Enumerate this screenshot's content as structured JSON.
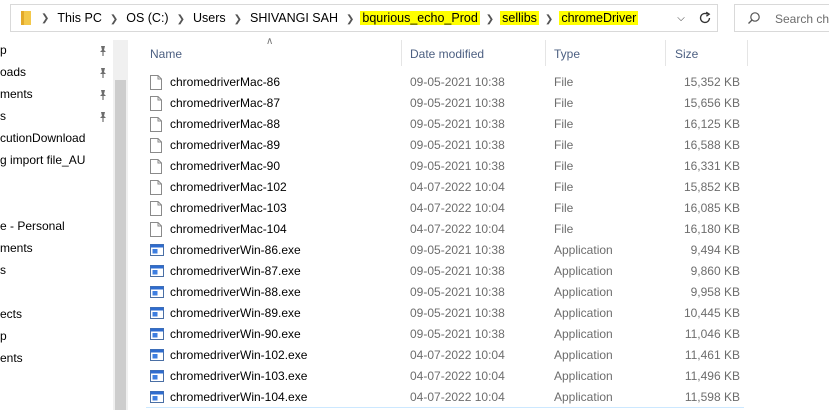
{
  "address": {
    "crumbs": [
      {
        "label": "This PC",
        "highlight": false
      },
      {
        "label": "OS (C:)",
        "highlight": false
      },
      {
        "label": "Users",
        "highlight": false
      },
      {
        "label": "SHIVANGI SAH",
        "highlight": false
      },
      {
        "label": "bqurious_echo_Prod",
        "highlight": true
      },
      {
        "label": "sellibs",
        "highlight": true
      },
      {
        "label": "chromeDriver",
        "highlight": true
      }
    ],
    "highlight_color": "#ffff00"
  },
  "search": {
    "placeholder": "Search chr"
  },
  "nav": {
    "items": [
      {
        "label": "p",
        "pinned": true
      },
      {
        "label": "oads",
        "pinned": true
      },
      {
        "label": "ments",
        "pinned": true
      },
      {
        "label": "s",
        "pinned": true
      },
      {
        "label": "cutionDownload",
        "pinned": false
      },
      {
        "label": "g import file_AU",
        "pinned": false
      },
      {
        "label": "",
        "pinned": false
      },
      {
        "label": "",
        "pinned": false
      },
      {
        "label": "e - Personal",
        "pinned": false
      },
      {
        "label": "ments",
        "pinned": false
      },
      {
        "label": "s",
        "pinned": false
      },
      {
        "label": "",
        "pinned": false
      },
      {
        "label": "ects",
        "pinned": false
      },
      {
        "label": "p",
        "pinned": false
      },
      {
        "label": "ents",
        "pinned": false
      }
    ]
  },
  "columns": {
    "name": "Name",
    "date": "Date modified",
    "type": "Type",
    "size": "Size"
  },
  "files": [
    {
      "name": "chromedriverMac-86",
      "date": "09-05-2021 10:38",
      "type": "File",
      "size": "15,352 KB",
      "icon": "file-icon"
    },
    {
      "name": "chromedriverMac-87",
      "date": "09-05-2021 10:38",
      "type": "File",
      "size": "15,656 KB",
      "icon": "file-icon"
    },
    {
      "name": "chromedriverMac-88",
      "date": "09-05-2021 10:38",
      "type": "File",
      "size": "16,125 KB",
      "icon": "file-icon"
    },
    {
      "name": "chromedriverMac-89",
      "date": "09-05-2021 10:38",
      "type": "File",
      "size": "16,588 KB",
      "icon": "file-icon"
    },
    {
      "name": "chromedriverMac-90",
      "date": "09-05-2021 10:38",
      "type": "File",
      "size": "16,331 KB",
      "icon": "file-icon"
    },
    {
      "name": "chromedriverMac-102",
      "date": "04-07-2022 10:04",
      "type": "File",
      "size": "15,852 KB",
      "icon": "file-icon"
    },
    {
      "name": "chromedriverMac-103",
      "date": "04-07-2022 10:04",
      "type": "File",
      "size": "16,085 KB",
      "icon": "file-icon"
    },
    {
      "name": "chromedriverMac-104",
      "date": "04-07-2022 10:04",
      "type": "File",
      "size": "16,180 KB",
      "icon": "file-icon"
    },
    {
      "name": "chromedriverWin-86.exe",
      "date": "09-05-2021 10:38",
      "type": "Application",
      "size": "9,494 KB",
      "icon": "app-icon"
    },
    {
      "name": "chromedriverWin-87.exe",
      "date": "09-05-2021 10:38",
      "type": "Application",
      "size": "9,860 KB",
      "icon": "app-icon"
    },
    {
      "name": "chromedriverWin-88.exe",
      "date": "09-05-2021 10:38",
      "type": "Application",
      "size": "9,958 KB",
      "icon": "app-icon"
    },
    {
      "name": "chromedriverWin-89.exe",
      "date": "09-05-2021 10:38",
      "type": "Application",
      "size": "10,445 KB",
      "icon": "app-icon"
    },
    {
      "name": "chromedriverWin-90.exe",
      "date": "09-05-2021 10:38",
      "type": "Application",
      "size": "11,046 KB",
      "icon": "app-icon"
    },
    {
      "name": "chromedriverWin-102.exe",
      "date": "04-07-2022 10:04",
      "type": "Application",
      "size": "11,461 KB",
      "icon": "app-icon"
    },
    {
      "name": "chromedriverWin-103.exe",
      "date": "04-07-2022 10:04",
      "type": "Application",
      "size": "11,496 KB",
      "icon": "app-icon"
    },
    {
      "name": "chromedriverWin-104.exe",
      "date": "04-07-2022 10:04",
      "type": "Application",
      "size": "11,598 KB",
      "icon": "app-icon"
    }
  ]
}
